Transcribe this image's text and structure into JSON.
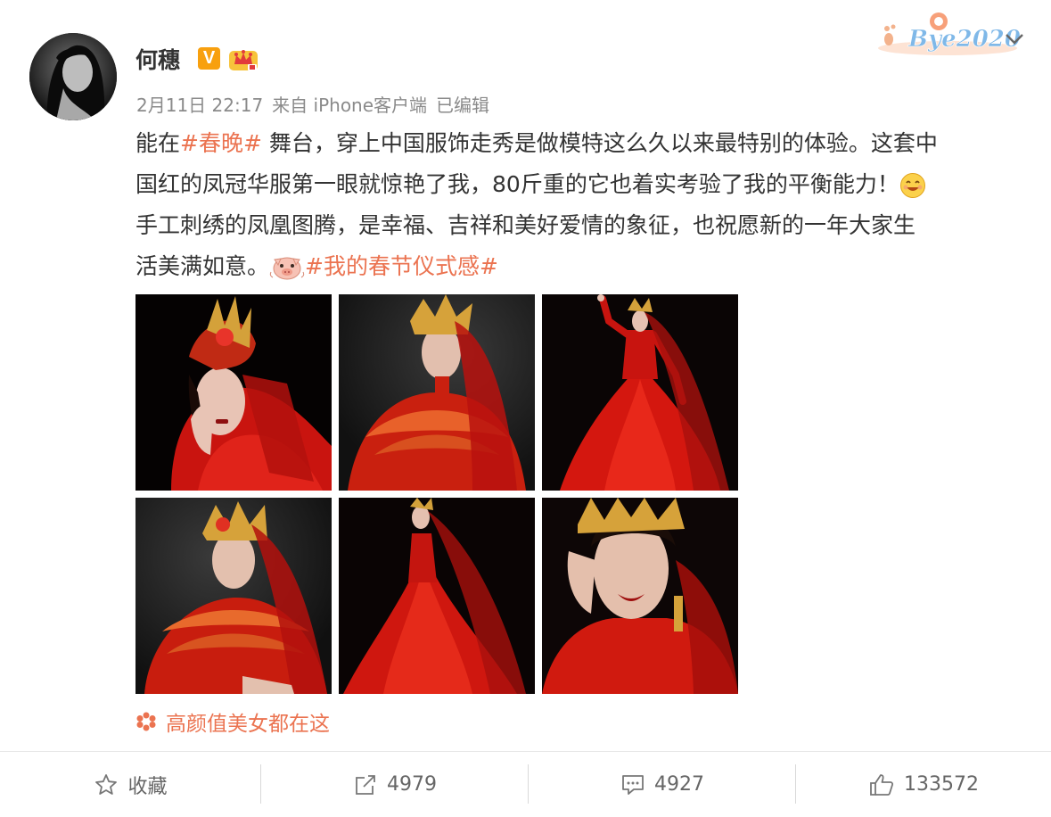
{
  "post": {
    "author_name": "何穗",
    "verified_badge": "V",
    "timestamp": "2月11日 22:17",
    "source": "来自 iPhone客户端",
    "edited": "已编辑",
    "brand_text": "Bye2020",
    "content_lines": [
      {
        "parts": [
          {
            "text": "能在",
            "type": "text"
          },
          {
            "text": "#春晚#",
            "type": "tag"
          },
          {
            "text": " 舞台，穿上中国服饰走秀是做模特这么久以来最特别的体验。这套中",
            "type": "text"
          }
        ]
      },
      {
        "parts": [
          {
            "text": "国红的凤冠华服第一眼就惊艳了我，80斤重的它也着实考验了我的平衡能力！",
            "type": "text"
          }
        ]
      },
      {
        "parts": [
          {
            "text": "手工刺绣的凤凰图腾，是幸福、吉祥和美好爱情的象征，也祝愿新的一年大家生",
            "type": "text"
          }
        ]
      },
      {
        "parts": [
          {
            "text": "活美满如意。",
            "type": "text"
          },
          {
            "text": "#我的春节仪式感#",
            "type": "tag"
          }
        ]
      }
    ],
    "emojis": [
      "smile-emoji",
      "pig-emoji"
    ],
    "photos": [
      {
        "name": "photo-1",
        "pose": "close-hand-face"
      },
      {
        "name": "photo-2",
        "pose": "side-bust"
      },
      {
        "name": "photo-3",
        "pose": "full-gown-arm-raised"
      },
      {
        "name": "photo-4",
        "pose": "bust-hands"
      },
      {
        "name": "photo-5",
        "pose": "full-gown"
      },
      {
        "name": "photo-6",
        "pose": "close-face"
      }
    ],
    "album_link": "高颜值美女都在这"
  },
  "actions": [
    {
      "name": "favorite",
      "label": "收藏",
      "icon": "star-icon"
    },
    {
      "name": "repost",
      "label": "4979",
      "icon": "share-icon"
    },
    {
      "name": "comment",
      "label": "4927",
      "icon": "comment-icon"
    },
    {
      "name": "like",
      "label": "133572",
      "icon": "thumbs-up-icon"
    }
  ],
  "colors": {
    "tag": "#eb7350",
    "text": "#333333",
    "meta": "#8a8a8a",
    "badge": "#f8a00e"
  }
}
